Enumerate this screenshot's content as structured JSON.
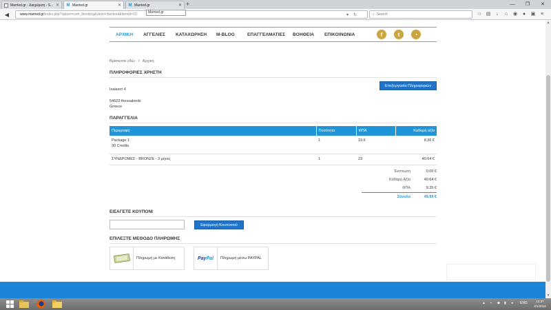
{
  "browser": {
    "tabs": [
      {
        "label": "Married.gr - Διαχείριση - S..."
      },
      {
        "label": "Married.gr"
      },
      {
        "label": "Married.gr"
      }
    ],
    "new_tab_symbol": "+",
    "find_text": "Married.gr",
    "url_host": "www.married.gr",
    "url_path": "/index.php?option=com_ibooking&view=checkout&Itemid=10",
    "search_placeholder": "Search"
  },
  "site": {
    "nav": [
      {
        "label": "ΑΡΧΙΚΗ",
        "active": true
      },
      {
        "label": "ΑΓΓΕΛΙΕΣ",
        "active": false
      },
      {
        "label": "ΚΑΤΑΧΩΡΗΣΗ",
        "active": false
      },
      {
        "label": "M-BLOG",
        "active": false
      },
      {
        "label": "ΕΠΑΓΓΕΛΜΑΤΙΕΣ",
        "active": false
      },
      {
        "label": "ΒΟΗΘΕΙΑ",
        "active": false
      },
      {
        "label": "ΕΠΙΚΟΙΝΩΝΙΑ",
        "active": false
      }
    ],
    "breadcrumb": {
      "prefix": "Βρίσκεστε εδώ:",
      "separator": "/",
      "current": "Αρχική"
    }
  },
  "user_info": {
    "title": "ΠΛΗΡΟΦΟΡΙΕΣ ΧΡΗΣΤΗ",
    "address": "Isaiasrri 4",
    "postal": "54622 thessaloniki",
    "country": "Greece",
    "edit_button": "Επεξεργασία Πληροφοριών"
  },
  "order": {
    "title": "ΠΑΡΑΓΓΕΛΙΑ",
    "columns": [
      "Περιγραφή",
      "Ποσότητα",
      "ΦΠΑ",
      "Καθαρή αξία"
    ],
    "rows": [
      {
        "description": "Package 1",
        "subline": "30 Credits",
        "qty": "1",
        "vat": "19.6",
        "net": "8.36 €"
      },
      {
        "description": "ΣΥΝΔΡΟΜΕΣ - BRONZE - 3 μήνες",
        "subline": "",
        "qty": "1",
        "vat": "23",
        "net": "40.64 €"
      }
    ],
    "totals": [
      {
        "label": "Έκπτωση",
        "value": "0.00 €"
      },
      {
        "label": "Καθαρή Αξία",
        "value": "40.64 €"
      },
      {
        "label": "ΦΠΑ",
        "value": "9.35 €"
      },
      {
        "label": "Σύνολο",
        "value": "49.99 €"
      }
    ]
  },
  "coupon": {
    "title": "ΕΙΣΑΓΕΤΕ ΚΟΥΠΟΝΙ",
    "input_value": "",
    "apply_button": "Εφαρμογή Κουπονιού"
  },
  "payment": {
    "title": "ΕΠΙΛΕΞΤΕ ΜΕΘΟΔΟ ΠΛΗΡΩΜΗΣ",
    "methods": [
      {
        "label": "Πληρωμή με Κατάθεση",
        "icon": "bank-deposit-icon"
      },
      {
        "label": "Πληρωμή μέσω PAYPAL",
        "icon": "paypal-icon",
        "logo_text_1": "Pay",
        "logo_text_2": "Pal"
      }
    ]
  },
  "taskbar": {
    "lang": "ENG",
    "time": "12:37",
    "date": "2/1/2016"
  },
  "colors": {
    "accent": "#1f95d8",
    "button": "#1f74c9",
    "social": "#c9a640",
    "footer": "#1b86d9"
  }
}
